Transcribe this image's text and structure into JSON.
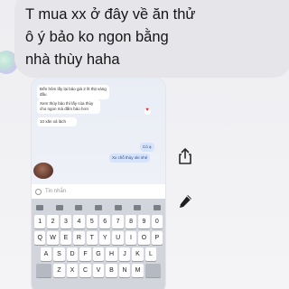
{
  "message": {
    "lines": [
      "T mua xx ở đây về ăn thử",
      "ô ý bảo ko ngon bằng",
      "nhà thùy haha"
    ]
  },
  "screenshot": {
    "chat_messages": [
      {
        "direction": "in",
        "text": "Đến hôm lấy lại bảo giá 2 lít thịt vàng đấu"
      },
      {
        "direction": "in",
        "text": "Xem thùy bảo thì lấy của thùy cho ngon mà đắm bảo hơn"
      },
      {
        "direction": "in",
        "text": "10 xăn xả lách"
      },
      {
        "direction": "out",
        "text": "Có ạ"
      },
      {
        "direction": "out",
        "text": "Xx chỗ thùy oki nhé"
      }
    ],
    "composer_placeholder": "Tin nhắn",
    "keyboard": {
      "row1": [
        "1",
        "2",
        "3",
        "4",
        "5",
        "6",
        "7",
        "8",
        "9",
        "0"
      ],
      "row2": [
        "Q",
        "W",
        "E",
        "R",
        "T",
        "Y",
        "U",
        "I",
        "O",
        "P"
      ],
      "row3": [
        "A",
        "S",
        "D",
        "F",
        "G",
        "H",
        "J",
        "K",
        "L"
      ],
      "row4": [
        "Z",
        "X",
        "C",
        "V",
        "B",
        "N",
        "M"
      ]
    }
  },
  "icons": {
    "share": "share-icon",
    "edit": "edit-icon",
    "heart": "heart-reaction-icon"
  }
}
